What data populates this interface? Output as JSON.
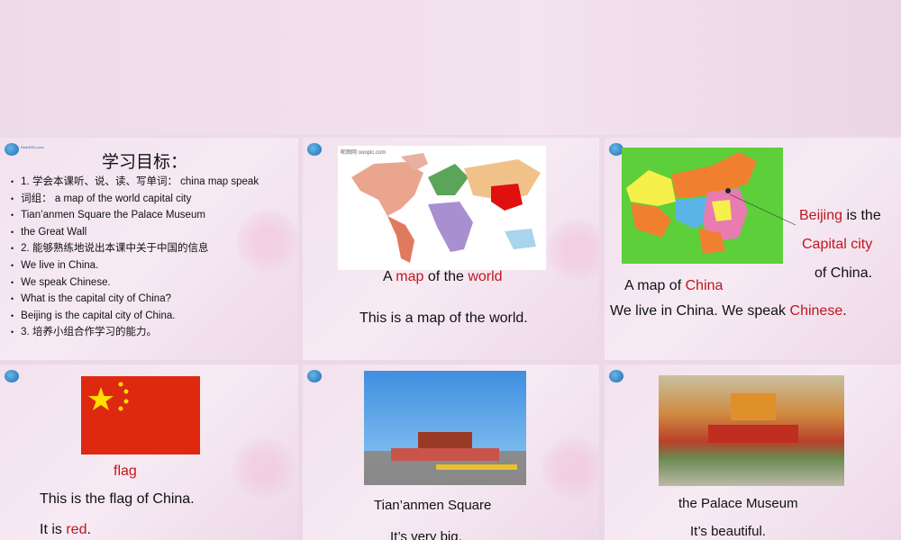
{
  "slide1": {
    "title": "学习目标：",
    "items": [
      "1. 学会本课听、说、读、写单词： china  map  speak",
      "词组：  a map of the world    capital city",
      "Tian’anmen Square    the Palace Museum",
      "the Great Wall",
      "2. 能够熟练地说出本课中关于中国的信息",
      "We live in China.",
      "We speak Chinese.",
      "What is the capital city of China?",
      "Beijing is the capital city of China.",
      "3. 培养小组合作学习的能力。"
    ]
  },
  "slide2": {
    "watermark": "昵图网 ooopic.com",
    "caption_a": "A",
    "caption_map": "map",
    "caption_of": "of the",
    "caption_world": "world",
    "sentence": "This is a map of the world."
  },
  "slide3": {
    "beijing": "Beijing",
    "is_the": "is the",
    "capital": "Capital city",
    "of_china": "of China.",
    "map_of": "A map of",
    "china": "China",
    "we_live": "We live in China. We speak",
    "chinese": "Chinese",
    "period": "."
  },
  "slide4": {
    "flag": "flag",
    "sentence": "This is the flag of China.",
    "it_is": "It is",
    "red": "red",
    "period": "."
  },
  "slide5": {
    "caption": "Tian’anmen Square",
    "sentence": "It’s very big."
  },
  "slide6": {
    "caption": "the Palace Museum",
    "sentence": "It’s beautiful."
  },
  "logo_text": "DearEDU.com",
  "colors": {
    "accent_red": "#c0161c",
    "flag_red": "#de2910",
    "flag_yellow": "#ffde00"
  }
}
